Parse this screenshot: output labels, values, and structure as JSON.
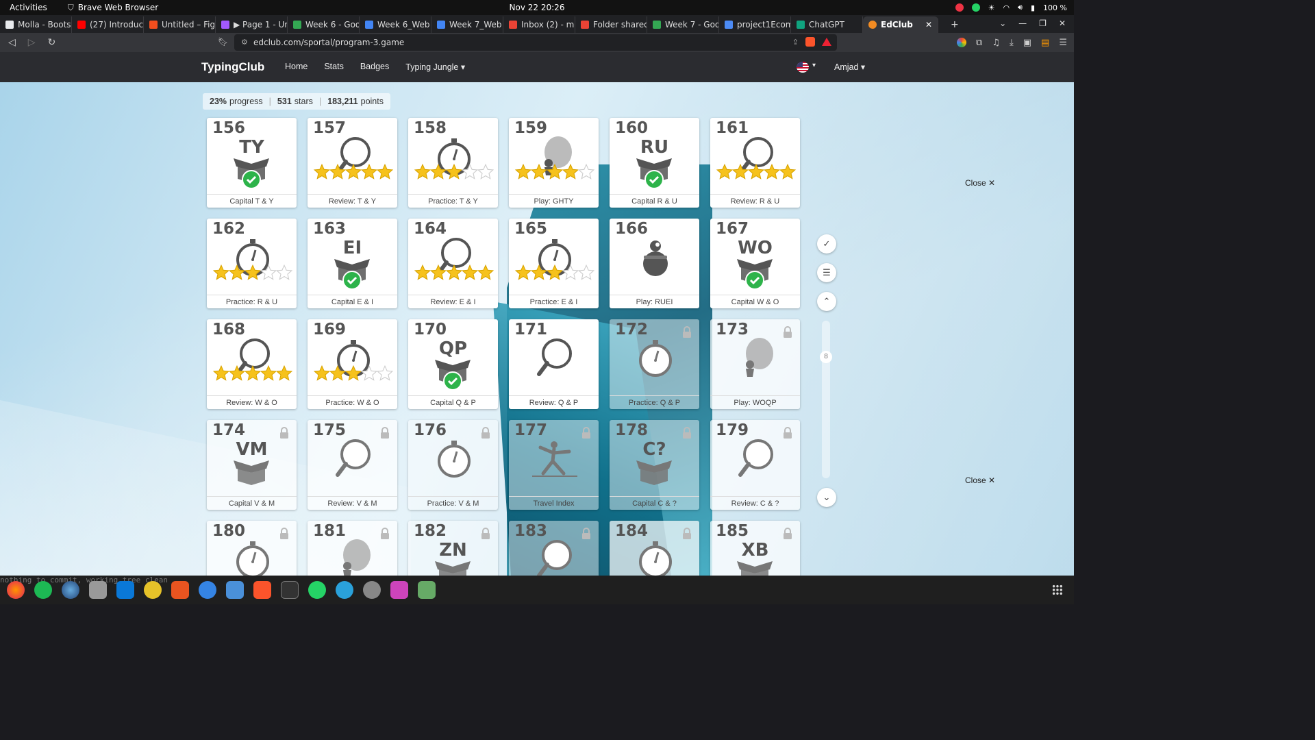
{
  "system_bar": {
    "activities": "Activities",
    "app_name": "Brave Web Browser",
    "datetime": "Nov 22  20:26",
    "battery": "100 %"
  },
  "browser": {
    "tabs": [
      {
        "label": "Molla - Bootst",
        "color": "#e8eaed"
      },
      {
        "label": "(27) Introduci",
        "color": "#ff0000"
      },
      {
        "label": "Untitled – Fig",
        "color": "#f24e1e"
      },
      {
        "label": "▶ Page 1 - Unt",
        "color": "#a259ff"
      },
      {
        "label": "Week 6 - Goog",
        "color": "#34a853"
      },
      {
        "label": "Week 6_Web",
        "color": "#4285f4"
      },
      {
        "label": "Week 7_Web",
        "color": "#4285f4"
      },
      {
        "label": "Inbox (2) - mo",
        "color": "#ea4335"
      },
      {
        "label": "Folder shared",
        "color": "#ea4335"
      },
      {
        "label": "Week 7 - Goog",
        "color": "#34a853"
      },
      {
        "label": "project1Ecom",
        "color": "#4c8bf5"
      },
      {
        "label": "ChatGPT",
        "color": "#10a37f"
      }
    ],
    "active_tab": {
      "label": "EdClub",
      "close": "✕"
    },
    "url": "edclub.com/sportal/program-3.game"
  },
  "site": {
    "brand": "TypingClub",
    "menu": [
      "Home",
      "Stats",
      "Badges",
      "Typing Jungle ▾"
    ],
    "user": "Amjad ▾"
  },
  "progress": {
    "percent": "23%",
    "percent_label": "progress",
    "stars": "531",
    "stars_label": "stars",
    "points": "183,211",
    "points_label": "points"
  },
  "lessons": [
    {
      "num": "156",
      "label": "Capital T & Y",
      "type": "box",
      "keys": "TY",
      "done": true
    },
    {
      "num": "157",
      "label": "Review: T & Y",
      "type": "review",
      "stars": 5
    },
    {
      "num": "158",
      "label": "Practice: T & Y",
      "type": "practice",
      "stars": 3
    },
    {
      "num": "159",
      "label": "Play: GHTY",
      "type": "play",
      "stars": 4
    },
    {
      "num": "160",
      "label": "Capital R & U",
      "type": "box",
      "keys": "RU",
      "done": true
    },
    {
      "num": "161",
      "label": "Review: R & U",
      "type": "review",
      "stars": 5
    },
    {
      "num": "162",
      "label": "Practice: R & U",
      "type": "practice",
      "stars": 3
    },
    {
      "num": "163",
      "label": "Capital E & I",
      "type": "box",
      "keys": "EI",
      "done": true
    },
    {
      "num": "164",
      "label": "Review: E & I",
      "type": "review",
      "stars": 5
    },
    {
      "num": "165",
      "label": "Practice: E & I",
      "type": "practice",
      "stars": 3
    },
    {
      "num": "166",
      "label": "Play: RUEI",
      "type": "play2",
      "stars": 0
    },
    {
      "num": "167",
      "label": "Capital W & O",
      "type": "box",
      "keys": "WO",
      "done": true
    },
    {
      "num": "168",
      "label": "Review: W & O",
      "type": "review",
      "stars": 5
    },
    {
      "num": "169",
      "label": "Practice: W & O",
      "type": "practice",
      "stars": 3
    },
    {
      "num": "170",
      "label": "Capital Q & P",
      "type": "box",
      "keys": "QP",
      "done": true
    },
    {
      "num": "171",
      "label": "Review: Q & P",
      "type": "review",
      "stars": 0
    },
    {
      "num": "172",
      "label": "Practice: Q & P",
      "type": "practice",
      "locked": true,
      "faded": true
    },
    {
      "num": "173",
      "label": "Play: WOQP",
      "type": "play",
      "locked": true
    },
    {
      "num": "174",
      "label": "Capital V & M",
      "type": "box",
      "keys": "VM",
      "locked": true
    },
    {
      "num": "175",
      "label": "Review: V & M",
      "type": "review",
      "locked": true
    },
    {
      "num": "176",
      "label": "Practice: V & M",
      "type": "practice",
      "locked": true,
      "faded": true
    },
    {
      "num": "177",
      "label": "Travel Index",
      "type": "travel",
      "locked": true,
      "faded": true
    },
    {
      "num": "178",
      "label": "Capital C & ?",
      "type": "box",
      "keys": "C?",
      "locked": true,
      "faded": true
    },
    {
      "num": "179",
      "label": "Review: C & ?",
      "type": "review",
      "locked": true
    },
    {
      "num": "180",
      "label": "",
      "type": "practice",
      "locked": true
    },
    {
      "num": "181",
      "label": "",
      "type": "play",
      "locked": true
    },
    {
      "num": "182",
      "label": "",
      "type": "box",
      "keys": "ZN",
      "locked": true,
      "faded": true
    },
    {
      "num": "183",
      "label": "",
      "type": "review",
      "locked": true,
      "faded": true
    },
    {
      "num": "184",
      "label": "",
      "type": "practice",
      "locked": true
    },
    {
      "num": "185",
      "label": "",
      "type": "box",
      "keys": "XB",
      "locked": true
    }
  ],
  "side": {
    "page": "8",
    "close_top": "Close ✕",
    "close_bottom": "Close ✕"
  },
  "taskbar": {
    "terminal_text": "nothing to commit, working tree clean"
  },
  "colors": {
    "accent_green": "#2db34a",
    "star_gold": "#f6c21c",
    "nav_bg": "#2b2c30"
  }
}
